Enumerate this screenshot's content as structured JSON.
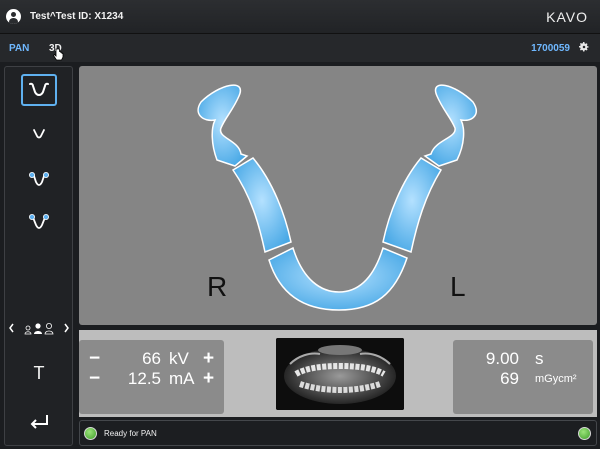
{
  "header": {
    "patient": "Test^Test  ID: X1234",
    "brand": "KAVO"
  },
  "mode_tabs": [
    {
      "label": "PAN",
      "active": true
    },
    {
      "label": "3D",
      "active": false
    }
  ],
  "device_id": "1700059",
  "sidebar": {
    "program_icons": [
      "full-arch-icon",
      "small-arch-icon",
      "tmj-closed-icon",
      "tmj-open-icon"
    ],
    "selected_program": 0,
    "text_button": "T",
    "back_icon": "return-icon"
  },
  "view": {
    "right_label": "R",
    "left_label": "L"
  },
  "exposure": {
    "kv_value": "66",
    "kv_unit": "kV",
    "ma_value": "12.5",
    "ma_unit": "mA",
    "time_value": "9.00",
    "time_unit": "s",
    "dose_value": "69",
    "dose_unit": "mGycm²"
  },
  "status": {
    "text": "Ready for PAN"
  },
  "colors": {
    "accent": "#6fb8ff",
    "jaw": "#52aee8",
    "ready": "#4caf34"
  }
}
